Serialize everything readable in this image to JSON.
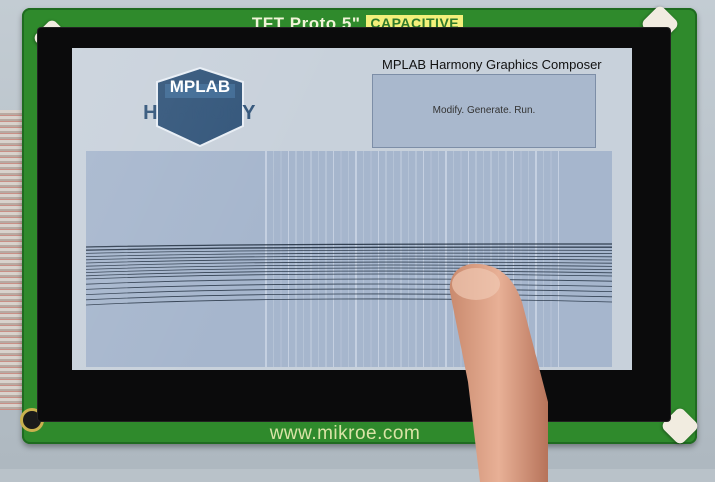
{
  "board": {
    "title": "TFT Proto 5\"",
    "title_tag": "CAPACITIVE",
    "url": "www.mikroe.com"
  },
  "screen": {
    "logo": {
      "badge": "MPLAB",
      "name": "HARMONY"
    },
    "app_title": "MPLAB Harmony Graphics Composer",
    "label_text": "Modify. Generate. Run."
  },
  "colors": {
    "pcb": "#2f8a2c",
    "lcd_background": "#c8d1db",
    "label_box": "#a9b8cd",
    "drawing_canvas": "#a6b6cd",
    "logo_blue": "#32557a",
    "silkscreen_highlight": "#f3f07a"
  },
  "icons": [
    "mounting-standoff-icon",
    "finger-icon",
    "mplab-harmony-logo-icon"
  ]
}
